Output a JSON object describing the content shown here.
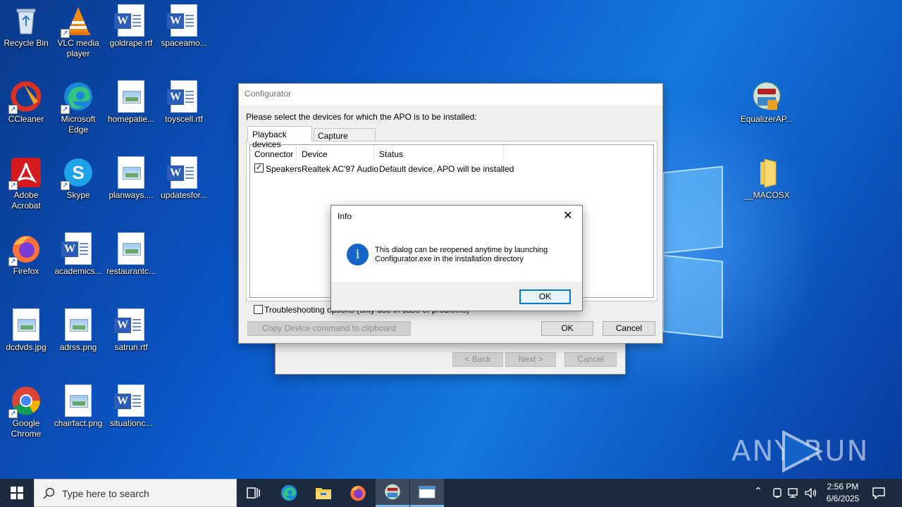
{
  "desktop": {
    "icons": [
      {
        "label": "Recycle Bin",
        "icon": "recycle-bin-icon"
      },
      {
        "label": "VLC media player",
        "icon": "vlc-icon"
      },
      {
        "label": "goldrape.rtf",
        "icon": "word-doc-icon"
      },
      {
        "label": "spaceamo...",
        "icon": "word-doc-icon"
      },
      {
        "label": "CCleaner",
        "icon": "ccleaner-icon"
      },
      {
        "label": "Microsoft Edge",
        "icon": "edge-icon"
      },
      {
        "label": "homepatie...",
        "icon": "image-file-icon"
      },
      {
        "label": "toyscell.rtf",
        "icon": "word-doc-icon"
      },
      {
        "label": "Adobe Acrobat",
        "icon": "acrobat-icon"
      },
      {
        "label": "Skype",
        "icon": "skype-icon"
      },
      {
        "label": "planways....",
        "icon": "image-file-icon"
      },
      {
        "label": "updatesfor...",
        "icon": "word-doc-icon"
      },
      {
        "label": "Firefox",
        "icon": "firefox-icon"
      },
      {
        "label": "academics...",
        "icon": "word-doc-icon"
      },
      {
        "label": "restaurantc...",
        "icon": "image-file-icon"
      },
      {
        "label": "dcdvds.jpg",
        "icon": "image-file-icon"
      },
      {
        "label": "adrss.png",
        "icon": "image-file-icon"
      },
      {
        "label": "satrun.rtf",
        "icon": "word-doc-icon"
      },
      {
        "label": "Google Chrome",
        "icon": "chrome-icon"
      },
      {
        "label": "chairfact.png",
        "icon": "image-file-icon"
      },
      {
        "label": "situationc...",
        "icon": "word-doc-icon"
      },
      {
        "label": "EqualizerAP...",
        "icon": "installer-icon"
      },
      {
        "label": "__MACOSX",
        "icon": "folder-icon"
      }
    ],
    "watermark": "ANY RUN"
  },
  "wizard": {
    "back": "< Back",
    "next": "Next >",
    "cancel": "Cancel"
  },
  "configurator": {
    "title": "Configurator",
    "prompt": "Please select the devices for which the APO is to be installed:",
    "tabs": [
      "Playback devices",
      "Capture devices"
    ],
    "columns": [
      "Connector",
      "Device",
      "Status"
    ],
    "rows": [
      {
        "checked": true,
        "connector": "Speakers",
        "device": "Realtek AC'97 Audio",
        "status": "Default device, APO will be installed"
      }
    ],
    "troubleshooting": "Troubleshooting options (only use in case of problems)",
    "copy_button": "Copy Device command to clipboard",
    "ok": "OK",
    "cancel": "Cancel"
  },
  "info_dialog": {
    "title": "Info",
    "message_line1": "This dialog can be reopened anytime by launching",
    "message_line2": "Configurator.exe in the installation directory",
    "ok": "OK"
  },
  "taskbar": {
    "search_placeholder": "Type here to search",
    "time": "2:56 PM",
    "date": "6/6/2025"
  },
  "colors": {
    "accent": "#0078d7",
    "taskbar": "#1b2a3c",
    "desktop": "#0b56c8"
  }
}
